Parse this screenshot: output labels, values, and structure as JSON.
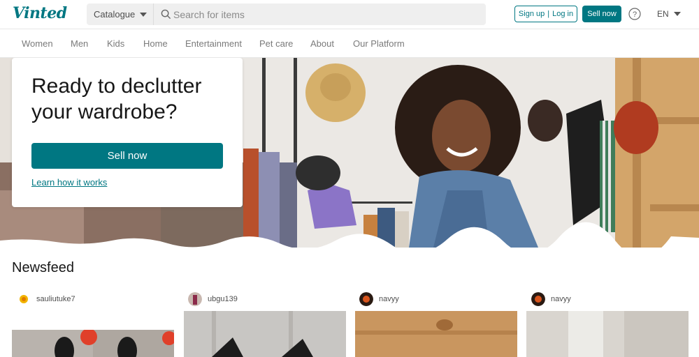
{
  "header": {
    "logo": "Vinted",
    "catalogue_label": "Catalogue",
    "search_placeholder": "Search for items",
    "signup_label": "Sign up",
    "separator": "|",
    "login_label": "Log in",
    "sell_now_label": "Sell now",
    "language": "EN"
  },
  "nav": {
    "items": [
      "Women",
      "Men",
      "Kids",
      "Home",
      "Entertainment",
      "Pet care",
      "About",
      "Our Platform"
    ]
  },
  "hero": {
    "title": "Ready to declutter your wardrobe?",
    "sell_button": "Sell now",
    "learn_link": "Learn how it works"
  },
  "newsfeed": {
    "title": "Newsfeed",
    "items": [
      {
        "username": "sauliutuke7"
      },
      {
        "username": "ubgu139"
      },
      {
        "username": "navyy"
      },
      {
        "username": "navyy"
      }
    ]
  },
  "colors": {
    "brand": "#007782",
    "text": "#171717",
    "muted": "#7a7a7a"
  },
  "icons": [
    "caret-down-icon",
    "search-icon",
    "help-icon"
  ]
}
